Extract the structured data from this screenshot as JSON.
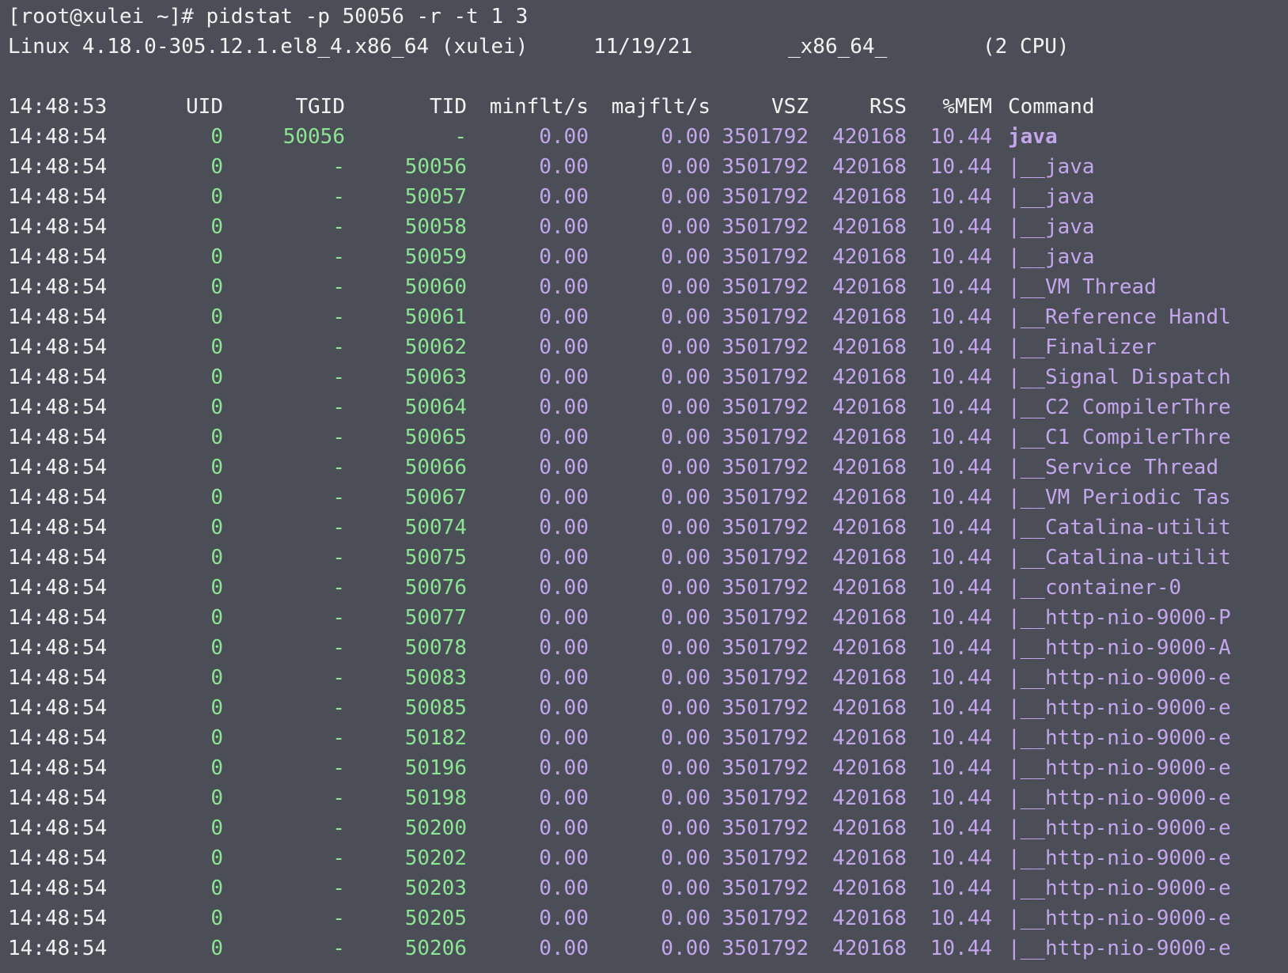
{
  "prompt_line": "[root@xulei ~]# pidstat -p 50056 -r -t 1 3",
  "sysinfo": {
    "kernel": "Linux 4.18.0-305.12.1.el8_4.x86_64 (xulei)",
    "date": "11/19/21",
    "arch": "_x86_64_",
    "cpus": "(2 CPU)"
  },
  "header": {
    "time": "14:48:53",
    "uid": "UID",
    "tgid": "TGID",
    "tid": "TID",
    "minflt": "minflt/s",
    "majflt": "majflt/s",
    "vsz": "VSZ",
    "rss": "RSS",
    "mem": "%MEM",
    "command": "Command"
  },
  "colors": {
    "background": "#4b4e57",
    "green": "#8ce593",
    "purple": "#c4a6ec",
    "text": "#f2f2f2"
  },
  "rows": [
    {
      "time": "14:48:54",
      "uid": "0",
      "tgid": "50056",
      "tid": "-",
      "minflt": "0.00",
      "majflt": "0.00",
      "vsz": "3501792",
      "rss": "420168",
      "mem": "10.44",
      "command": "java",
      "main": true
    },
    {
      "time": "14:48:54",
      "uid": "0",
      "tgid": "-",
      "tid": "50056",
      "minflt": "0.00",
      "majflt": "0.00",
      "vsz": "3501792",
      "rss": "420168",
      "mem": "10.44",
      "command": "|__java"
    },
    {
      "time": "14:48:54",
      "uid": "0",
      "tgid": "-",
      "tid": "50057",
      "minflt": "0.00",
      "majflt": "0.00",
      "vsz": "3501792",
      "rss": "420168",
      "mem": "10.44",
      "command": "|__java"
    },
    {
      "time": "14:48:54",
      "uid": "0",
      "tgid": "-",
      "tid": "50058",
      "minflt": "0.00",
      "majflt": "0.00",
      "vsz": "3501792",
      "rss": "420168",
      "mem": "10.44",
      "command": "|__java"
    },
    {
      "time": "14:48:54",
      "uid": "0",
      "tgid": "-",
      "tid": "50059",
      "minflt": "0.00",
      "majflt": "0.00",
      "vsz": "3501792",
      "rss": "420168",
      "mem": "10.44",
      "command": "|__java"
    },
    {
      "time": "14:48:54",
      "uid": "0",
      "tgid": "-",
      "tid": "50060",
      "minflt": "0.00",
      "majflt": "0.00",
      "vsz": "3501792",
      "rss": "420168",
      "mem": "10.44",
      "command": "|__VM Thread"
    },
    {
      "time": "14:48:54",
      "uid": "0",
      "tgid": "-",
      "tid": "50061",
      "minflt": "0.00",
      "majflt": "0.00",
      "vsz": "3501792",
      "rss": "420168",
      "mem": "10.44",
      "command": "|__Reference Handl"
    },
    {
      "time": "14:48:54",
      "uid": "0",
      "tgid": "-",
      "tid": "50062",
      "minflt": "0.00",
      "majflt": "0.00",
      "vsz": "3501792",
      "rss": "420168",
      "mem": "10.44",
      "command": "|__Finalizer"
    },
    {
      "time": "14:48:54",
      "uid": "0",
      "tgid": "-",
      "tid": "50063",
      "minflt": "0.00",
      "majflt": "0.00",
      "vsz": "3501792",
      "rss": "420168",
      "mem": "10.44",
      "command": "|__Signal Dispatch"
    },
    {
      "time": "14:48:54",
      "uid": "0",
      "tgid": "-",
      "tid": "50064",
      "minflt": "0.00",
      "majflt": "0.00",
      "vsz": "3501792",
      "rss": "420168",
      "mem": "10.44",
      "command": "|__C2 CompilerThre"
    },
    {
      "time": "14:48:54",
      "uid": "0",
      "tgid": "-",
      "tid": "50065",
      "minflt": "0.00",
      "majflt": "0.00",
      "vsz": "3501792",
      "rss": "420168",
      "mem": "10.44",
      "command": "|__C1 CompilerThre"
    },
    {
      "time": "14:48:54",
      "uid": "0",
      "tgid": "-",
      "tid": "50066",
      "minflt": "0.00",
      "majflt": "0.00",
      "vsz": "3501792",
      "rss": "420168",
      "mem": "10.44",
      "command": "|__Service Thread"
    },
    {
      "time": "14:48:54",
      "uid": "0",
      "tgid": "-",
      "tid": "50067",
      "minflt": "0.00",
      "majflt": "0.00",
      "vsz": "3501792",
      "rss": "420168",
      "mem": "10.44",
      "command": "|__VM Periodic Tas"
    },
    {
      "time": "14:48:54",
      "uid": "0",
      "tgid": "-",
      "tid": "50074",
      "minflt": "0.00",
      "majflt": "0.00",
      "vsz": "3501792",
      "rss": "420168",
      "mem": "10.44",
      "command": "|__Catalina-utilit"
    },
    {
      "time": "14:48:54",
      "uid": "0",
      "tgid": "-",
      "tid": "50075",
      "minflt": "0.00",
      "majflt": "0.00",
      "vsz": "3501792",
      "rss": "420168",
      "mem": "10.44",
      "command": "|__Catalina-utilit"
    },
    {
      "time": "14:48:54",
      "uid": "0",
      "tgid": "-",
      "tid": "50076",
      "minflt": "0.00",
      "majflt": "0.00",
      "vsz": "3501792",
      "rss": "420168",
      "mem": "10.44",
      "command": "|__container-0"
    },
    {
      "time": "14:48:54",
      "uid": "0",
      "tgid": "-",
      "tid": "50077",
      "minflt": "0.00",
      "majflt": "0.00",
      "vsz": "3501792",
      "rss": "420168",
      "mem": "10.44",
      "command": "|__http-nio-9000-P"
    },
    {
      "time": "14:48:54",
      "uid": "0",
      "tgid": "-",
      "tid": "50078",
      "minflt": "0.00",
      "majflt": "0.00",
      "vsz": "3501792",
      "rss": "420168",
      "mem": "10.44",
      "command": "|__http-nio-9000-A"
    },
    {
      "time": "14:48:54",
      "uid": "0",
      "tgid": "-",
      "tid": "50083",
      "minflt": "0.00",
      "majflt": "0.00",
      "vsz": "3501792",
      "rss": "420168",
      "mem": "10.44",
      "command": "|__http-nio-9000-e"
    },
    {
      "time": "14:48:54",
      "uid": "0",
      "tgid": "-",
      "tid": "50085",
      "minflt": "0.00",
      "majflt": "0.00",
      "vsz": "3501792",
      "rss": "420168",
      "mem": "10.44",
      "command": "|__http-nio-9000-e"
    },
    {
      "time": "14:48:54",
      "uid": "0",
      "tgid": "-",
      "tid": "50182",
      "minflt": "0.00",
      "majflt": "0.00",
      "vsz": "3501792",
      "rss": "420168",
      "mem": "10.44",
      "command": "|__http-nio-9000-e"
    },
    {
      "time": "14:48:54",
      "uid": "0",
      "tgid": "-",
      "tid": "50196",
      "minflt": "0.00",
      "majflt": "0.00",
      "vsz": "3501792",
      "rss": "420168",
      "mem": "10.44",
      "command": "|__http-nio-9000-e"
    },
    {
      "time": "14:48:54",
      "uid": "0",
      "tgid": "-",
      "tid": "50198",
      "minflt": "0.00",
      "majflt": "0.00",
      "vsz": "3501792",
      "rss": "420168",
      "mem": "10.44",
      "command": "|__http-nio-9000-e"
    },
    {
      "time": "14:48:54",
      "uid": "0",
      "tgid": "-",
      "tid": "50200",
      "minflt": "0.00",
      "majflt": "0.00",
      "vsz": "3501792",
      "rss": "420168",
      "mem": "10.44",
      "command": "|__http-nio-9000-e"
    },
    {
      "time": "14:48:54",
      "uid": "0",
      "tgid": "-",
      "tid": "50202",
      "minflt": "0.00",
      "majflt": "0.00",
      "vsz": "3501792",
      "rss": "420168",
      "mem": "10.44",
      "command": "|__http-nio-9000-e"
    },
    {
      "time": "14:48:54",
      "uid": "0",
      "tgid": "-",
      "tid": "50203",
      "minflt": "0.00",
      "majflt": "0.00",
      "vsz": "3501792",
      "rss": "420168",
      "mem": "10.44",
      "command": "|__http-nio-9000-e"
    },
    {
      "time": "14:48:54",
      "uid": "0",
      "tgid": "-",
      "tid": "50205",
      "minflt": "0.00",
      "majflt": "0.00",
      "vsz": "3501792",
      "rss": "420168",
      "mem": "10.44",
      "command": "|__http-nio-9000-e"
    },
    {
      "time": "14:48:54",
      "uid": "0",
      "tgid": "-",
      "tid": "50206",
      "minflt": "0.00",
      "majflt": "0.00",
      "vsz": "3501792",
      "rss": "420168",
      "mem": "10.44",
      "command": "|__http-nio-9000-e"
    }
  ]
}
